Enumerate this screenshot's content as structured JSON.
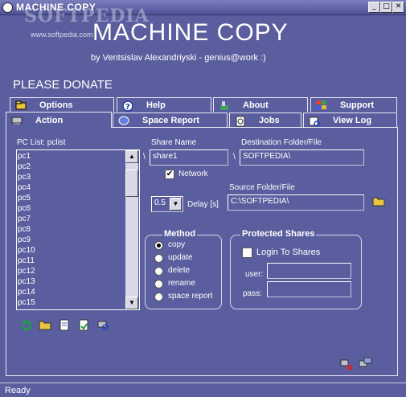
{
  "window": {
    "title": "MACHINE COPY",
    "watermark": "SOFTPEDIA",
    "watermark_url": "www.softpedia.com",
    "minimize": "_",
    "maximize": "□",
    "close": "✕"
  },
  "header": {
    "app_name": "MACHINE COPY",
    "byline": "by Ventsislav Alexandriyski - genius@work :)",
    "donate": "PLEASE DONATE"
  },
  "tabs": {
    "row1": [
      {
        "label": "Options",
        "icon": "options-icon"
      },
      {
        "label": "Help",
        "icon": "help-icon"
      },
      {
        "label": "About",
        "icon": "about-icon"
      },
      {
        "label": "Support",
        "icon": "support-icon"
      }
    ],
    "row2": [
      {
        "label": "Action",
        "icon": "action-icon",
        "active": true
      },
      {
        "label": "Space Report",
        "icon": "space-report-icon"
      },
      {
        "label": "Jobs",
        "icon": "jobs-icon"
      },
      {
        "label": "View Log",
        "icon": "view-log-icon"
      }
    ]
  },
  "pc_list": {
    "label": "PC List: pclist",
    "items": [
      "pc1",
      "pc2",
      "pc3",
      "pc4",
      "pc5",
      "pc6",
      "pc7",
      "pc8",
      "pc9",
      "pc10",
      "pc11",
      "pc12",
      "pc13",
      "pc14",
      "pc15"
    ],
    "scroll_up": "▲",
    "scroll_down": "▼"
  },
  "share": {
    "label": "Share Name",
    "value": "share1",
    "sep": "\\",
    "network_label": "Network",
    "network_checked": "✔"
  },
  "destination": {
    "label": "Destination Folder/File",
    "value": "SOFTPEDIA\\",
    "sep": "\\"
  },
  "source": {
    "label": "Source Folder/File",
    "value": "C:\\SOFTPEDIA\\"
  },
  "delay": {
    "value": "0.5",
    "arrow": "▼",
    "label": "Delay [s]"
  },
  "method": {
    "title": "Method",
    "options": [
      "copy",
      "update",
      "delete",
      "rename",
      "space report"
    ],
    "selected": "copy"
  },
  "protected": {
    "title": "Protected Shares",
    "login_label": "Login To Shares",
    "user_label": "user:",
    "pass_label": "pass:"
  },
  "status": {
    "text": "Ready"
  },
  "colors": {
    "background": "#5a5e9e",
    "border": "#e8e8f4"
  }
}
